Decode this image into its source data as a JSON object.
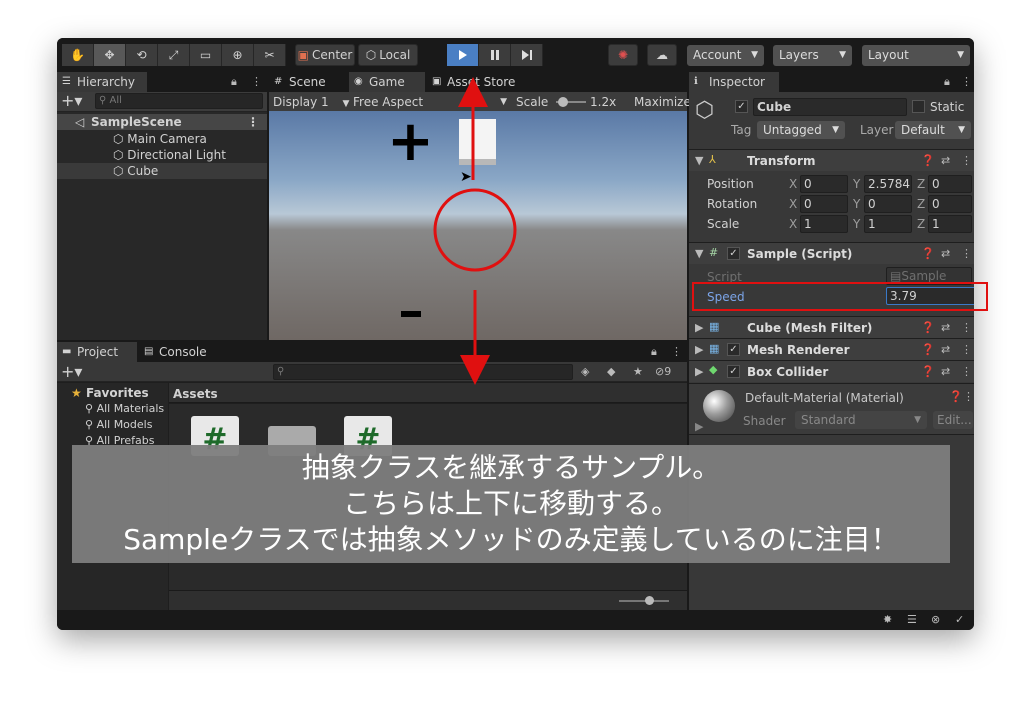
{
  "toolbar": {
    "pivot_label": "Center",
    "space_label": "Local",
    "account_label": "Account",
    "layers_label": "Layers",
    "layout_label": "Layout"
  },
  "hierarchy": {
    "tab_label": "Hierarchy",
    "search_placeholder": "All",
    "scene_name": "SampleScene",
    "items": [
      {
        "label": "Main Camera"
      },
      {
        "label": "Directional Light"
      },
      {
        "label": "Cube"
      }
    ]
  },
  "center_tabs": {
    "scene": "Scene",
    "game": "Game",
    "asset_store": "Asset Store"
  },
  "game_bar": {
    "display": "Display 1",
    "aspect": "Free Aspect",
    "scale_label": "Scale",
    "scale_value": "1.2x",
    "maximize": "Maximize"
  },
  "game_view": {
    "plus_symbol": "+",
    "minus_symbol": "-"
  },
  "project": {
    "tab_project": "Project",
    "tab_console": "Console",
    "favorites_label": "Favorites",
    "favorites": [
      "All Materials",
      "All Models",
      "All Prefabs"
    ],
    "assets_label": "Assets",
    "hidden_count": "9"
  },
  "inspector": {
    "tab_label": "Inspector",
    "object_name": "Cube",
    "static_label": "Static",
    "tag_label": "Tag",
    "tag_value": "Untagged",
    "layer_label": "Layer",
    "layer_value": "Default",
    "transform_label": "Transform",
    "position_label": "Position",
    "rotation_label": "Rotation",
    "scale_label": "Scale",
    "position": {
      "x": "0",
      "y": "2.5784",
      "z": "0"
    },
    "rotation": {
      "x": "0",
      "y": "0",
      "z": "0"
    },
    "scale": {
      "x": "1",
      "y": "1",
      "z": "1"
    },
    "sample_script_label": "Sample (Script)",
    "script_label": "Script",
    "script_value": "Sample",
    "speed_label": "Speed",
    "speed_value": "3.79",
    "mesh_filter_label": "Cube (Mesh Filter)",
    "mesh_renderer_label": "Mesh Renderer",
    "box_collider_label": "Box Collider",
    "material_label": "Default-Material (Material)",
    "shader_label": "Shader",
    "shader_value": "Standard",
    "edit_label": "Edit..."
  },
  "caption": {
    "line1": "抽象クラスを継承するサンプル。",
    "line2": "こちらは上下に移動する。",
    "line3": "Sampleクラスでは抽象メソッドのみ定義しているのに注目！"
  },
  "colors": {
    "annotation_red": "#e01010",
    "play_blue": "#4a7fc4",
    "field_label_blue": "#7ba4e8"
  }
}
